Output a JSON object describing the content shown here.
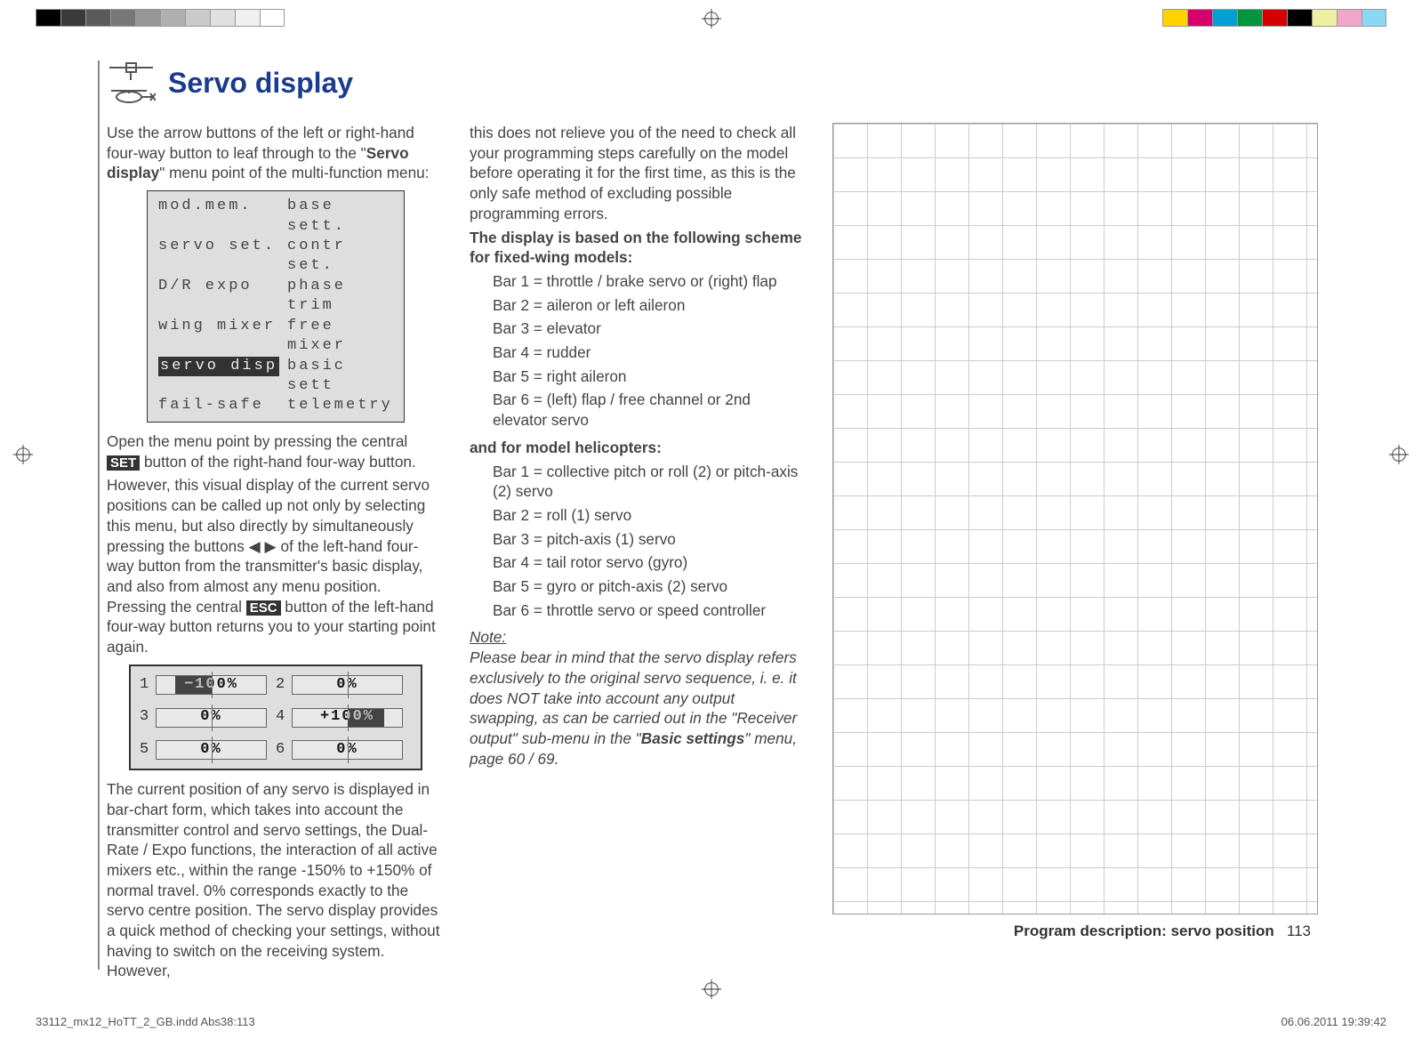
{
  "header": {
    "title": "Servo display"
  },
  "menu": {
    "rows": [
      {
        "l": "mod.mem.",
        "r": "base sett."
      },
      {
        "l": "servo set.",
        "r": "contr set."
      },
      {
        "l": "D/R expo",
        "r": "phase trim"
      },
      {
        "l": "wing mixer",
        "r": "free mixer"
      },
      {
        "l": "servo disp",
        "r": "basic sett",
        "sel": true
      },
      {
        "l": "fail-safe",
        "r": "telemetry"
      }
    ]
  },
  "col1": {
    "p1_a": "Use the arrow buttons of the left or right-hand four-way button to leaf through to the \"",
    "p1_b": "Servo display",
    "p1_c": "\" menu point of the multi-function menu:",
    "p2_a": "Open the menu point by pressing the central ",
    "p2_key": "SET",
    "p2_b": " button of the right-hand four-way button.",
    "p3_a": "However, this visual display of the current servo positions can be called up not only by selecting this menu, but also directly by simultaneously pressing the buttons ◀ ▶ of the left-hand four-way button from the transmitter's basic display, and also from almost any menu position. Pressing the central ",
    "p3_key": "ESC",
    "p3_b": " button of the left-hand four-way button returns you to your starting point again.",
    "p4": "The current position of any servo is displayed in bar-chart form, which takes into account the transmitter control and servo settings, the Dual-Rate / Expo functions, the interaction of all active mixers etc., within the range -150% to +150% of normal travel. 0% corresponds exactly to the servo centre position. The servo display provides a quick method of checking your settings, without having to switch on the receiving system. However,"
  },
  "chart_data": {
    "type": "bar",
    "title": "Servo display",
    "series": [
      {
        "name": "1",
        "value": -100,
        "label": "−100%"
      },
      {
        "name": "2",
        "value": 0,
        "label": "0%"
      },
      {
        "name": "3",
        "value": 0,
        "label": "0%"
      },
      {
        "name": "4",
        "value": 100,
        "label": "+100%"
      },
      {
        "name": "5",
        "value": 0,
        "label": "0%"
      },
      {
        "name": "6",
        "value": 0,
        "label": "0%"
      }
    ],
    "xlabel": "",
    "ylabel": "",
    "range": [
      -150,
      150
    ]
  },
  "col2": {
    "p1": "this does not relieve you of the need to check all your programming steps carefully on the model before operating it for the first time, as this is the only safe method of excluding possible programming errors.",
    "h1": "The display is based on the following scheme for fixed-wing models:",
    "fixed": [
      "Bar 1 = throttle / brake servo or (right) flap",
      "Bar 2 = aileron or left aileron",
      "Bar 3 = elevator",
      "Bar 4 = rudder",
      "Bar 5 = right aileron",
      "Bar 6 = (left) flap / free channel or 2nd elevator servo"
    ],
    "h2": "and for model helicopters:",
    "heli": [
      "Bar 1 = collective pitch or roll (2) or pitch-axis (2) servo",
      "Bar 2 = roll (1) servo",
      "Bar 3 = pitch-axis (1) servo",
      "Bar 4 = tail rotor servo (gyro)",
      "Bar 5 = gyro or pitch-axis (2) servo",
      "Bar 6 = throttle servo or speed controller"
    ],
    "note_label": "Note:",
    "note_a": "Please bear in mind that the servo display refers exclusively to the original servo sequence, i. e. it does NOT take into account any output swapping, as can be carried out in the \"Receiver output\" sub-menu in the \"",
    "note_b": "Basic settings",
    "note_c": "\" menu, page 60 / 69."
  },
  "footer": {
    "desc": "Program description: servo position",
    "page": "113"
  },
  "slug": {
    "file": "33112_mx12_HoTT_2_GB.indd   Abs38:113",
    "dt": "06.06.2011   19:39:42"
  }
}
